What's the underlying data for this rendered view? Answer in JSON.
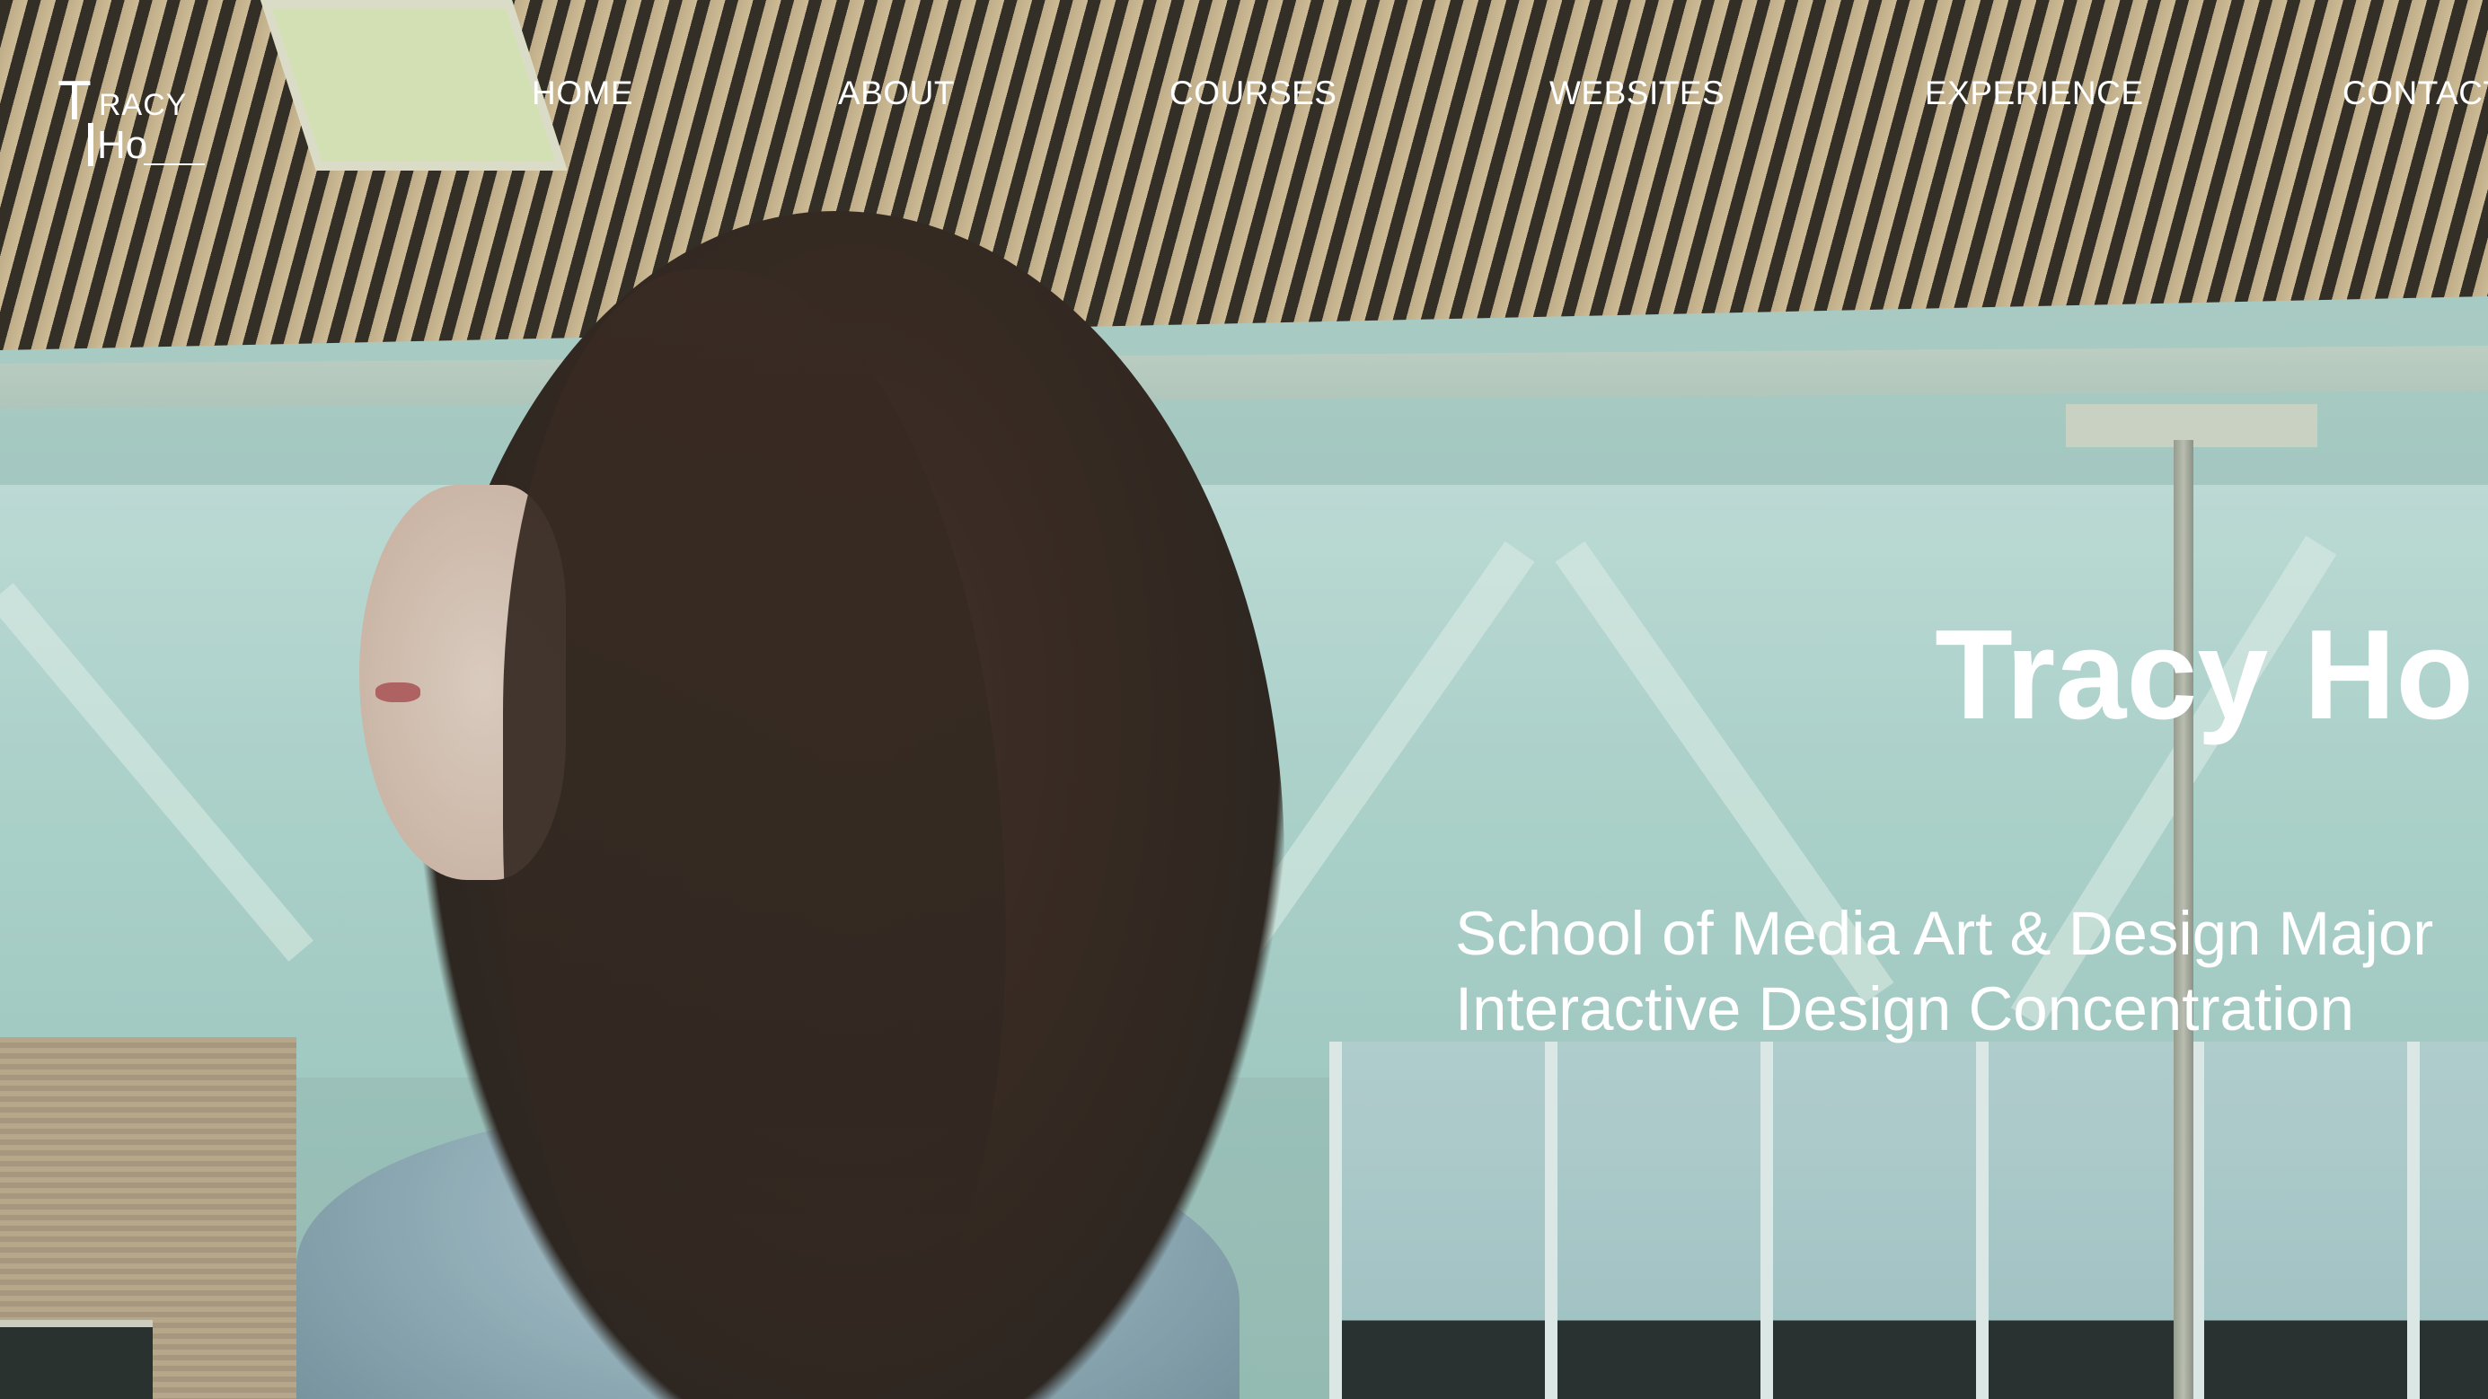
{
  "logo": {
    "letter_t": "T",
    "racy": "RACY",
    "ho": "Ho",
    "alt_text": "TRACY HO"
  },
  "nav": {
    "items": [
      {
        "label": "HOME"
      },
      {
        "label": "ABOUT"
      },
      {
        "label": "COURSES"
      },
      {
        "label": "WEBSITES"
      },
      {
        "label": "EXPERIENCE"
      },
      {
        "label": "CONTACT"
      }
    ]
  },
  "hero": {
    "name": "Tracy Ho",
    "subtitle_line1": "School of Media Art & Design Major",
    "subtitle_line2": "Interactive Design Concentration",
    "background_image": "portrait photo of woman with long brown hair in profile, glass atrium background"
  },
  "colors": {
    "text": "#ffffff",
    "hair": "#2c1812",
    "wall": "#a9ccc6"
  }
}
